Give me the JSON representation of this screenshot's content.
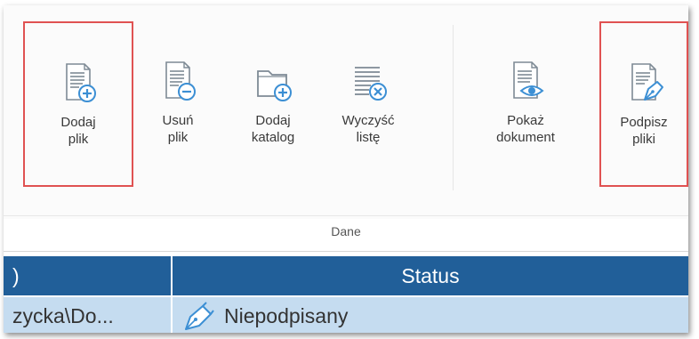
{
  "ribbon": {
    "buttons": [
      {
        "id": "add-file",
        "label": "Dodaj\nplik",
        "icon": "doc-plus-icon",
        "highlighted": true
      },
      {
        "id": "remove-file",
        "label": "Usuń\nplik",
        "icon": "doc-minus-icon",
        "highlighted": false
      },
      {
        "id": "add-folder",
        "label": "Dodaj\nkatalog",
        "icon": "folder-plus-icon",
        "highlighted": false
      },
      {
        "id": "clear-list",
        "label": "Wyczyść\nlistę",
        "icon": "list-clear-icon",
        "highlighted": false
      },
      {
        "id": "show-document",
        "label": "Pokaż\ndokument",
        "icon": "doc-eye-icon",
        "highlighted": false
      },
      {
        "id": "sign-files",
        "label": "Podpisz\npliki",
        "icon": "doc-pen-icon",
        "highlighted": true
      }
    ],
    "group_label": "Dane"
  },
  "table": {
    "left_header": ")",
    "status_header": "Status",
    "rows": [
      {
        "path": "zycka\\Do...",
        "status": "Niepodpisany",
        "status_icon": "pen-nib-icon"
      }
    ]
  },
  "colors": {
    "header_bg": "#215f99",
    "row_bg": "#c5dcf0",
    "highlight_border": "#e05252",
    "icon_blue": "#3c8fd4",
    "icon_gray": "#8a95a0"
  }
}
